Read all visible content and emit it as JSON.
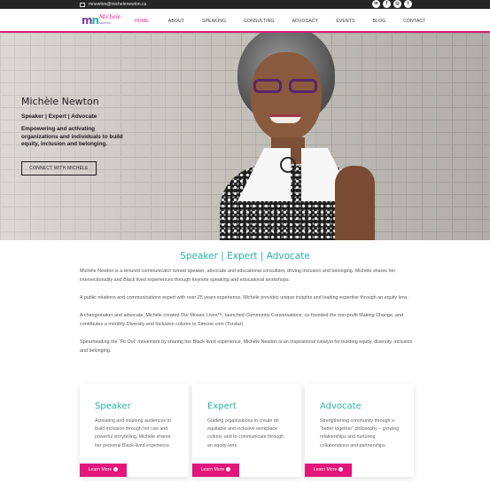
{
  "topbar": {
    "email": "mnewton@michelenewton.ca",
    "social": [
      {
        "icon": "linkedin-icon",
        "glyph": "in"
      },
      {
        "icon": "facebook-icon",
        "glyph": "f"
      },
      {
        "icon": "instagram-icon",
        "glyph": "◎"
      },
      {
        "icon": "twitter-icon",
        "glyph": "t"
      }
    ]
  },
  "logo": {
    "letters_1": "m",
    "letters_2": "n",
    "script": "Michèle",
    "tagline": "NEWTON"
  },
  "nav": {
    "items": [
      "HOME",
      "ABOUT",
      "SPEAKING",
      "CONSULTING",
      "ADVOCACY",
      "EVENTS",
      "BLOG",
      "CONTACT"
    ],
    "active": "HOME"
  },
  "hero": {
    "name": "Michèle Newton",
    "roles": "Speaker | Expert | Advocate",
    "mission": "Empowering and activating organizations and individuals to build equity, inclusion and belonging.",
    "cta": "CONNECT WITH MICHÈLE"
  },
  "content": {
    "title": "Speaker | Expert | Advocate",
    "paragraphs": [
      "Michèle Newton is a tenured communicator turned speaker, advocate and educational consultant, driving inclusion and belonging. Michèle shares her intersectionality and Black lived experiences through keynote speaking and educational workshops.",
      "A public relations and communications expert with over 25 years experience, Michèle provides unique insights and leading expertise through an equity lens.",
      "A changemaker and advocate, Michèle created Our Mosaic Lives™, launched Community Conversations, co-founded the non-profit Making Change, and contributes a monthly Diversity and Inclusion column to Simcoe.com (Torstar).",
      "Spearheading the “Fit Out” movement by sharing her Black-lived experience, Michèle Newton is an inspirational catalyst for building equity, diversity, inclusion and belonging."
    ]
  },
  "cards": [
    {
      "title": "Speaker",
      "text": "Activating and inspiring audiences to build inclusion through her raw and powerful storytelling, Michèle shares her personal Black-lived experience.",
      "button": "Learn More"
    },
    {
      "title": "Expert",
      "text": "Guiding organizations to create an equitable and inclusive workplace culture, and to communicate through an equity-lens.",
      "button": "Learn More"
    },
    {
      "title": "Advocate",
      "text": "Strengthening community through a “better together” philosophy – growing relationships and nurturing collaborations and partnerships.",
      "button": "Learn More"
    }
  ],
  "colors": {
    "accent_pink": "#e4157a",
    "accent_teal": "#2ab2a7",
    "topbar": "#262626"
  }
}
